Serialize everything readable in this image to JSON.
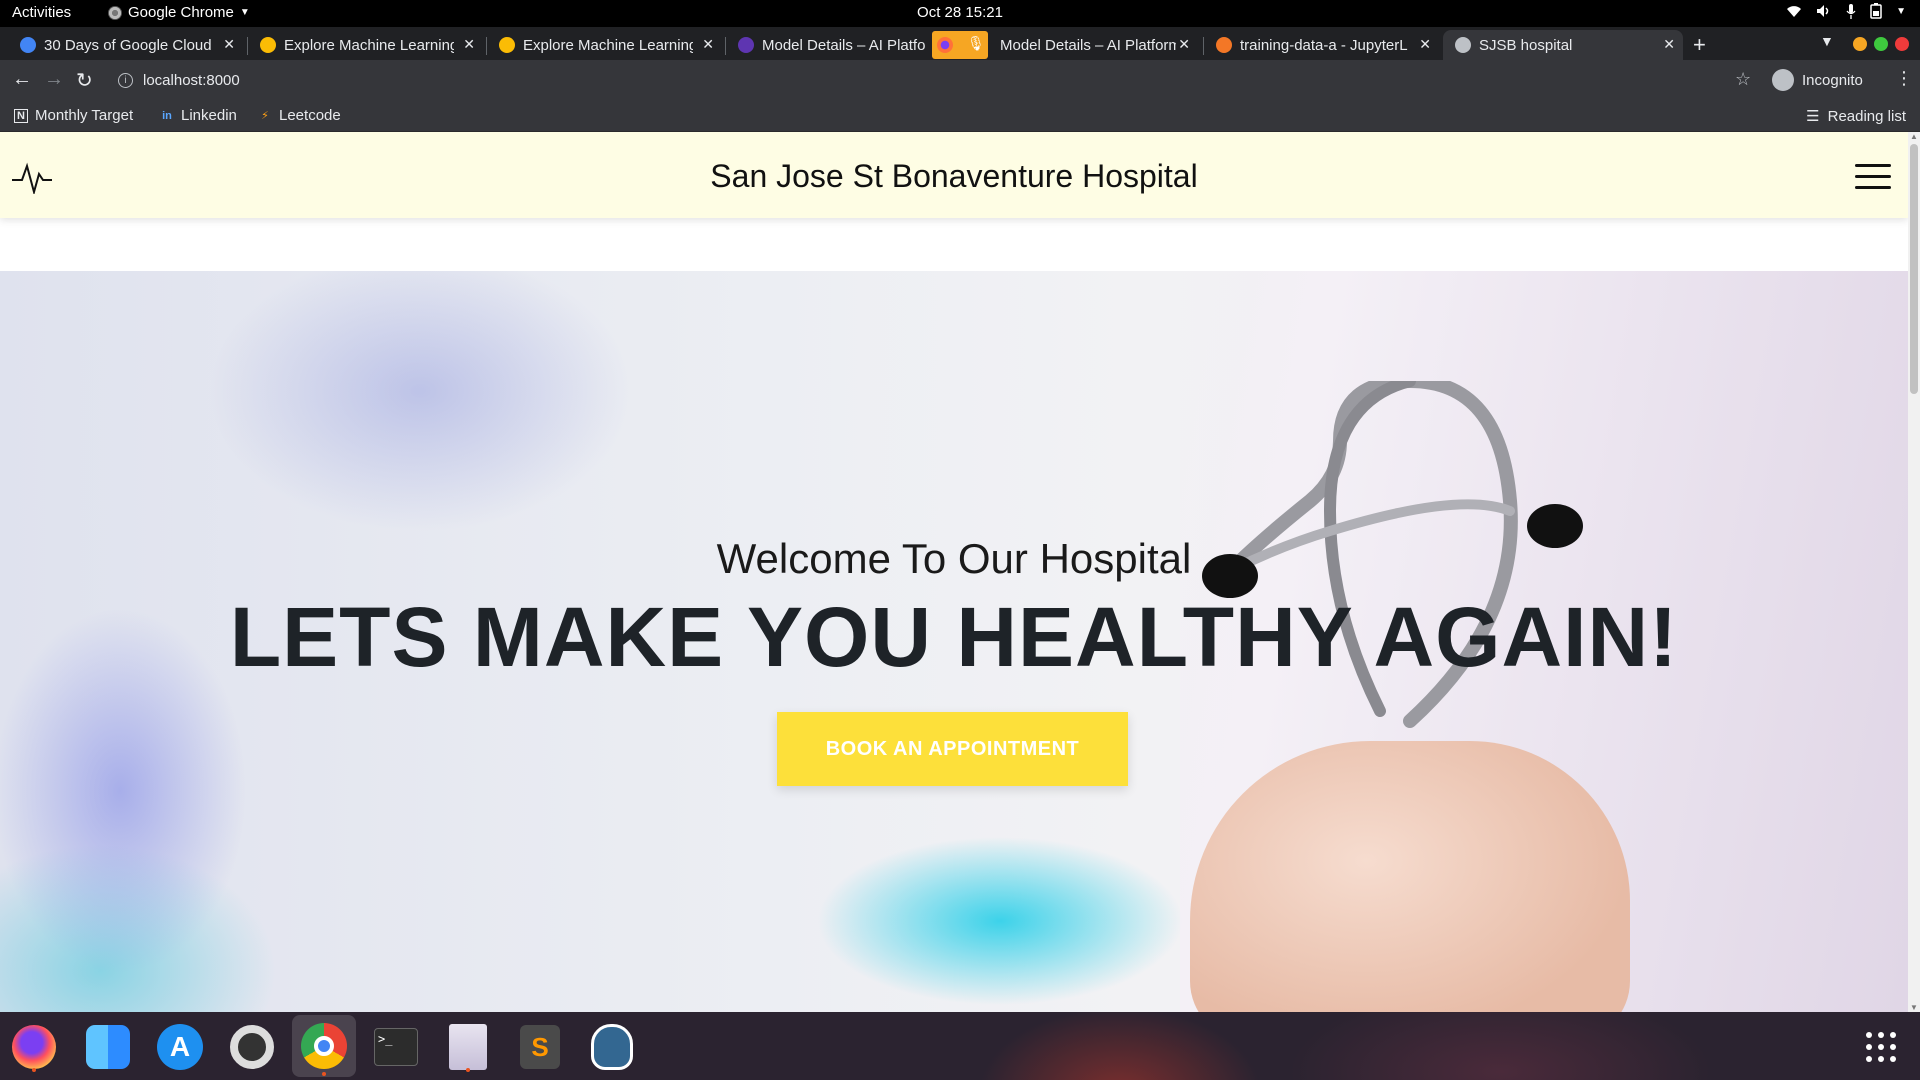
{
  "system_bar": {
    "activities": "Activities",
    "app_name": "Google Chrome",
    "clock": "Oct 28  15:21"
  },
  "tabs": [
    {
      "title": "30 Days of Google Cloud -",
      "favicon_color": "#4285f4"
    },
    {
      "title": "Explore Machine Learning",
      "favicon_color": "#fbbc05"
    },
    {
      "title": "Explore Machine Learning",
      "favicon_color": "#fbbc05"
    },
    {
      "title": "Model Details – AI Platform",
      "favicon_color": "#5e35b1"
    },
    {
      "title": "Model Details – AI Platform",
      "favicon_color": "#ff7139"
    },
    {
      "title": "training-data-a - JupyterL",
      "favicon_color": "#f37726"
    },
    {
      "title": "SJSB hospital",
      "favicon_color": "#bdc1c6",
      "active": true
    }
  ],
  "toolbar": {
    "url": "localhost:8000",
    "profile": "Incognito"
  },
  "bookmarks": {
    "items": [
      {
        "label": "Monthly Target",
        "icon": "notion-icon"
      },
      {
        "label": "Linkedin",
        "icon": "linkedin-icon"
      },
      {
        "label": "Leetcode",
        "icon": "leetcode-icon"
      }
    ],
    "reading_list": "Reading list"
  },
  "site": {
    "title": "San Jose St Bonaventure Hospital",
    "hero_subtitle": "Welcome To Our Hospital",
    "hero_headline": "LETS MAKE YOU HEALTHY AGAIN!",
    "cta_label": "BOOK AN APPOINTMENT",
    "header_bg": "#fefde4",
    "cta_color": "#fde03a"
  },
  "dock": [
    {
      "name": "firefox-icon",
      "running": true
    },
    {
      "name": "finder-icon",
      "running": false
    },
    {
      "name": "app-store-icon",
      "running": false
    },
    {
      "name": "help-icon",
      "running": false
    },
    {
      "name": "chrome-icon",
      "running": true,
      "active": true
    },
    {
      "name": "terminal-icon",
      "running": false
    },
    {
      "name": "text-editor-icon",
      "running": true
    },
    {
      "name": "sublime-text-icon",
      "running": false
    },
    {
      "name": "postgresql-icon",
      "running": false
    }
  ]
}
